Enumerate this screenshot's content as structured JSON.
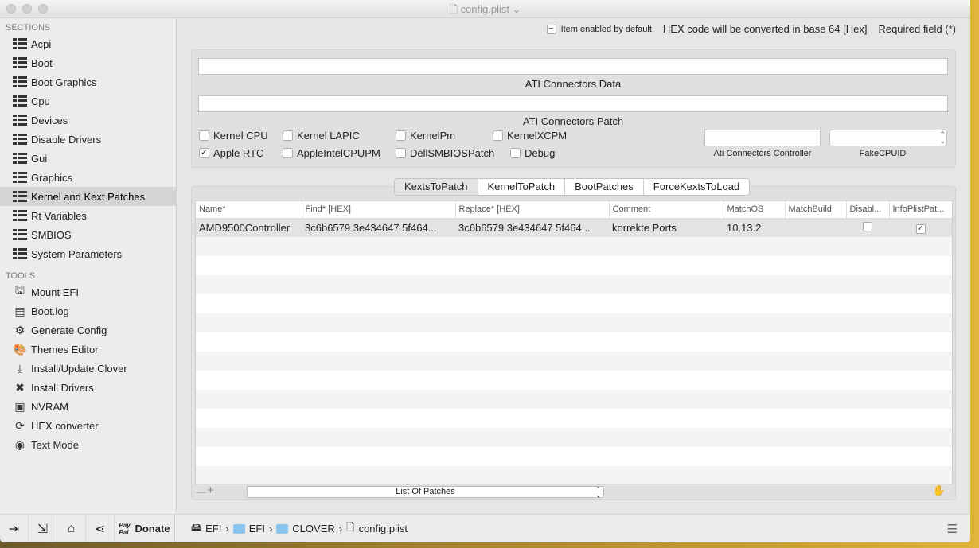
{
  "window": {
    "title": "config.plist"
  },
  "sidebar": {
    "sections_label": "SECTIONS",
    "sections": [
      {
        "label": "Acpi"
      },
      {
        "label": "Boot"
      },
      {
        "label": "Boot Graphics"
      },
      {
        "label": "Cpu"
      },
      {
        "label": "Devices"
      },
      {
        "label": "Disable Drivers"
      },
      {
        "label": "Gui"
      },
      {
        "label": "Graphics"
      },
      {
        "label": "Kernel and Kext Patches",
        "selected": true
      },
      {
        "label": "Rt Variables"
      },
      {
        "label": "SMBIOS"
      },
      {
        "label": "System Parameters"
      }
    ],
    "tools_label": "TOOLS",
    "tools": [
      {
        "label": "Mount EFI",
        "icon": "disk-icon"
      },
      {
        "label": "Boot.log",
        "icon": "log-icon"
      },
      {
        "label": "Generate Config",
        "icon": "gears-icon"
      },
      {
        "label": "Themes Editor",
        "icon": "palette-icon"
      },
      {
        "label": "Install/Update Clover",
        "icon": "download-icon"
      },
      {
        "label": "Install Drivers",
        "icon": "tools-icon"
      },
      {
        "label": "NVRAM",
        "icon": "chip-icon"
      },
      {
        "label": "HEX converter",
        "icon": "refresh-icon"
      },
      {
        "label": "Text Mode",
        "icon": "eye-icon"
      }
    ]
  },
  "info": {
    "enabled_default": "Item enabled by default",
    "hex_note": "HEX code will be converted in base 64 [Hex]",
    "required": "Required field (*)"
  },
  "ati": {
    "data_label": "ATI Connectors Data",
    "data_value": "",
    "patch_label": "ATI Connectors Patch",
    "patch_value": "",
    "controller_label": "Ati Connectors Controller",
    "fakecpuid_label": "FakeCPUID"
  },
  "checks": [
    {
      "label": "Kernel CPU",
      "checked": false
    },
    {
      "label": "Kernel LAPIC",
      "checked": false
    },
    {
      "label": "KernelPm",
      "checked": false
    },
    {
      "label": "KernelXCPM",
      "checked": false
    },
    {
      "label": "Apple RTC",
      "checked": true
    },
    {
      "label": "AppleIntelCPUPM",
      "checked": false
    },
    {
      "label": "DellSMBIOSPatch",
      "checked": false
    },
    {
      "label": "Debug",
      "checked": false
    }
  ],
  "tabs": [
    {
      "label": "KextsToPatch",
      "active": true
    },
    {
      "label": "KernelToPatch"
    },
    {
      "label": "BootPatches"
    },
    {
      "label": "ForceKextsToLoad"
    }
  ],
  "table": {
    "columns": [
      "Name*",
      "Find* [HEX]",
      "Replace* [HEX]",
      "Comment",
      "MatchOS",
      "MatchBuild",
      "Disabl...",
      "InfoPlistPat..."
    ],
    "rows": [
      {
        "name": "AMD9500Controller",
        "find": "3c6b6579 3e434647 5f464...",
        "replace": "3c6b6579 3e434647 5f464...",
        "comment": "korrekte Ports",
        "matchos": "10.13.2",
        "matchbuild": "",
        "disabled": false,
        "infoplist": true
      }
    ]
  },
  "footer": {
    "minus": "—",
    "plus": "+",
    "list_select": "List Of Patches"
  },
  "bottombar": {
    "donate": "Donate",
    "paypal": "Pay Pal",
    "path": [
      "EFI",
      "EFI",
      "CLOVER",
      "config.plist"
    ]
  }
}
